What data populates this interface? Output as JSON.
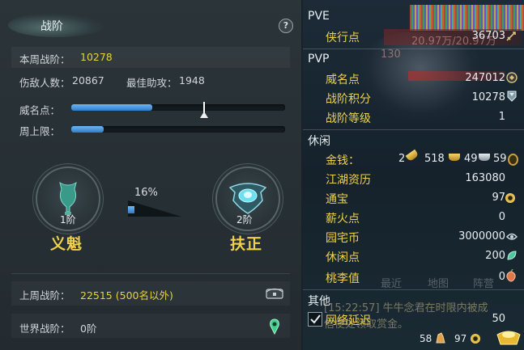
{
  "left": {
    "title": "战阶",
    "help": "?",
    "weekly_rank_label": "本周战阶：",
    "weekly_rank_value": "10278",
    "kills_label": "伤敌人数：",
    "kills_value": "20867",
    "assist_label": "最佳助攻：",
    "assist_value": "1948",
    "prestige_label": "威名点：",
    "prestige_progress": 0.38,
    "weekly_cap_label": "周上限：",
    "weekly_cap_progress": 0.15,
    "rank_left": {
      "level": "1阶",
      "name": "义魁"
    },
    "rank_right": {
      "level": "2阶",
      "name": "扶正"
    },
    "rank_progress_pct": "16%",
    "last_week_label": "上周战阶：",
    "last_week_value": "22515 (500名以外)",
    "world_label": "世界战阶：",
    "world_value": "0阶"
  },
  "right": {
    "pve_title": "PVE",
    "pve_items": [
      {
        "label": "侠行点",
        "value": "36703"
      }
    ],
    "pvp_title": "PVP",
    "pvp_items": [
      {
        "label": "威名点",
        "value": "247012"
      },
      {
        "label": "战阶积分",
        "value": "10278"
      },
      {
        "label": "战阶等级",
        "value": "1"
      }
    ],
    "leisure_title": "休闲",
    "money_label": "金钱：",
    "money_gold": "2",
    "money_silver_big": "518",
    "money_silver": "49",
    "money_copper": "59",
    "leisure_items": [
      {
        "label": "江湖资历",
        "value": "163080"
      },
      {
        "label": "通宝",
        "value": "97"
      },
      {
        "label": "薪火点",
        "value": "0"
      },
      {
        "label": "园宅币",
        "value": "3000000"
      },
      {
        "label": "休闲点",
        "value": "200"
      },
      {
        "label": "桃李值",
        "value": "0"
      }
    ],
    "other_title": "其他",
    "latency_label": "网络延迟",
    "latency_value": "50",
    "footer_a": "58",
    "footer_b": "97",
    "bg_banner_text": "20.97万/20.97万",
    "bg_num": "130",
    "tabs": [
      "最近",
      "地图",
      "阵营"
    ],
    "chat_line1": "[15:22:57] 牛牛念君在时限内被成",
    "chat_line2": "信使处领取赏金。"
  }
}
